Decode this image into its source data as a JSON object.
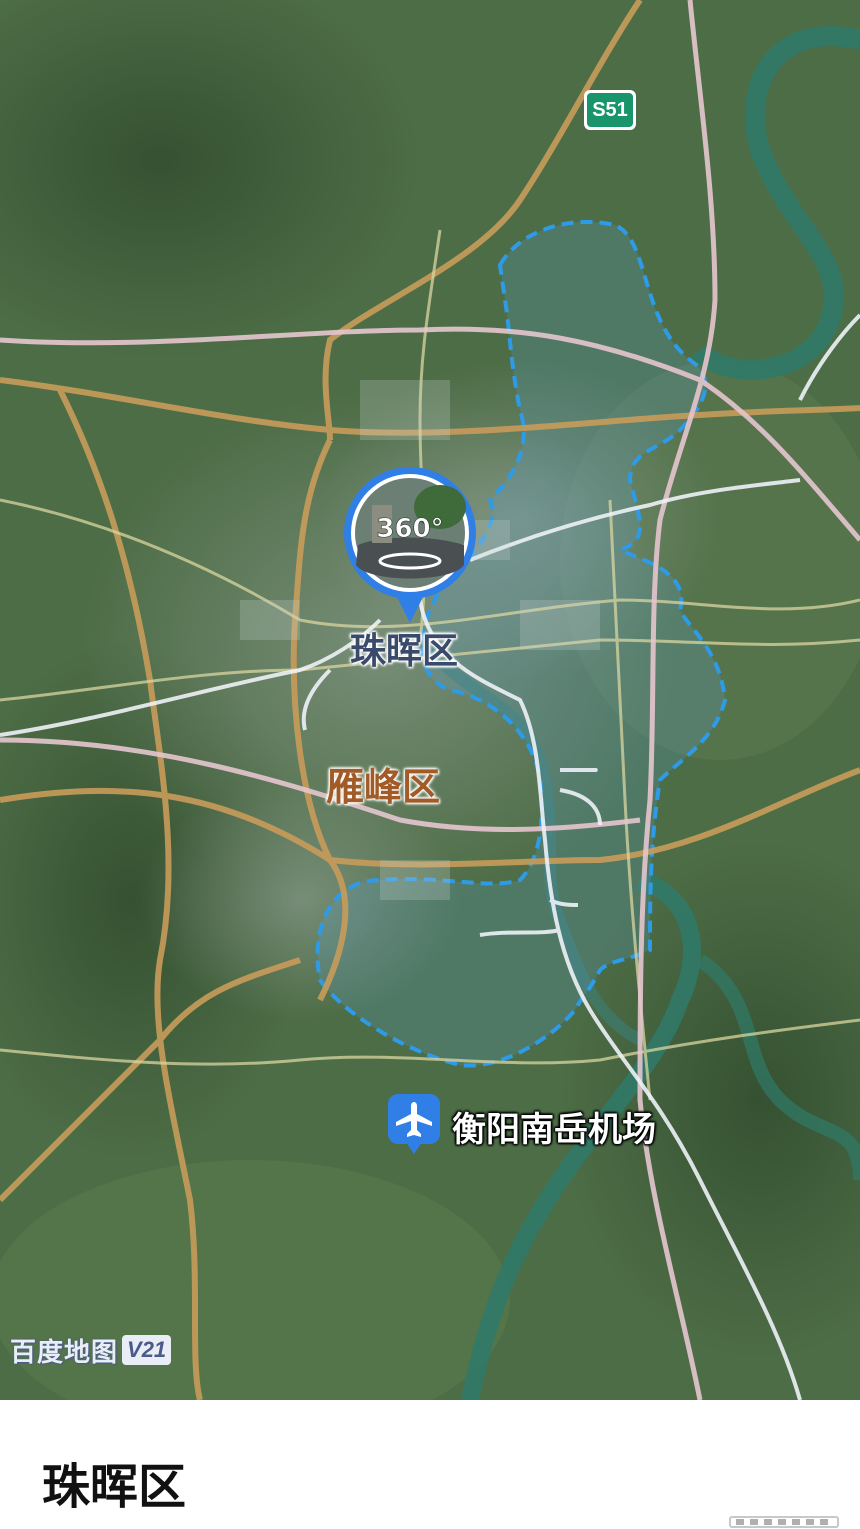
{
  "map": {
    "highway_shield": "S51",
    "district_label_main": "珠晖区",
    "district_label_secondary": "雁峰区",
    "airport_label": "衡阳南岳机场",
    "panorama_badge": "360°",
    "watermark": "百度地图",
    "watermark_version": "V21",
    "colors": {
      "boundary": "#2e9be8",
      "highway": "#c89c5a",
      "railway": "#e6c6cf",
      "river": "#2f7a6a",
      "district_main_text": "#3a4a6a",
      "district_secondary_text": "#a25a26",
      "shield_green": "#18956a",
      "panorama_blue": "#2f7fe6"
    },
    "icons": [
      "airplane-icon",
      "panorama-360-icon",
      "location-pin-icon"
    ]
  },
  "sheet": {
    "title": "珠晖区"
  }
}
